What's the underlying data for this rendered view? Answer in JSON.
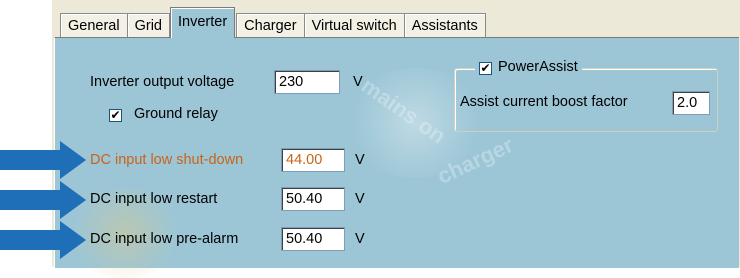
{
  "tabs": [
    {
      "label": "General"
    },
    {
      "label": "Grid"
    },
    {
      "label": "Inverter"
    },
    {
      "label": "Charger"
    },
    {
      "label": "Virtual switch"
    },
    {
      "label": "Assistants"
    }
  ],
  "inverter": {
    "output_voltage_label": "Inverter output voltage",
    "output_voltage_value": "230",
    "output_voltage_unit": "V",
    "ground_relay_label": "Ground relay",
    "ground_relay_checked": "✔",
    "shutdown_label": "DC input low shut-down",
    "shutdown_value": "44.00",
    "shutdown_unit": "V",
    "restart_label": "DC input low restart",
    "restart_value": "50.40",
    "restart_unit": "V",
    "prealarm_label": "DC input low pre-alarm",
    "prealarm_value": "50.40",
    "prealarm_unit": "V"
  },
  "powerassist": {
    "label": "PowerAssist",
    "checked": "✔",
    "boost_label": "Assist current boost factor",
    "boost_value": "2.0"
  },
  "colors": {
    "panel": "#9cc6d6",
    "arrow": "#1f6eb8",
    "highlight_label": "#c8641a"
  }
}
